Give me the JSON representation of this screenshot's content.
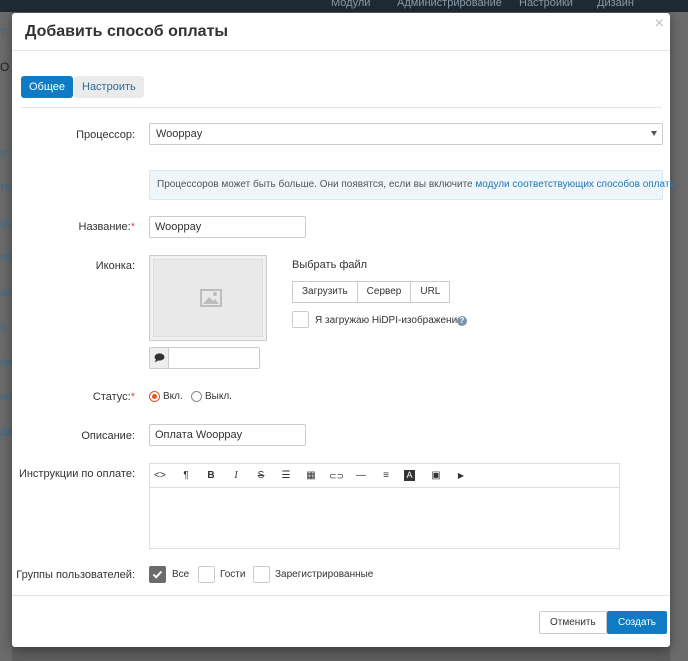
{
  "backdrop": {
    "menu": [
      "Модули",
      "Администрирование",
      "Настройки",
      "Дизайн"
    ],
    "side_letters": [
      "Т",
      "О",
      "ко",
      "та",
      "уд",
      "оба",
      "оп",
      "о",
      "ом",
      "ил",
      "ди"
    ]
  },
  "modal": {
    "title": "Добавить способ оплаты",
    "close": "×",
    "tabs": [
      {
        "label": "Общее",
        "active": true
      },
      {
        "label": "Настроить",
        "active": false
      }
    ]
  },
  "form": {
    "processor": {
      "label": "Процессор:",
      "value": "Wooppay"
    },
    "info": {
      "text": "Процессоров может быть больше. Они появятся, если вы включите ",
      "link": "модули соответствующих способов оплаты",
      "tail": "."
    },
    "name": {
      "label": "Название:",
      "required_mark": "*",
      "value": "Wooppay"
    },
    "icon": {
      "label": "Иконка:",
      "choose_file": "Выбрать файл",
      "buttons": [
        "Загрузить",
        "Сервер",
        "URL"
      ],
      "hidpi_label": "Я загружаю HiDPI-изображение.",
      "help": "?",
      "placeholder_icon": "image-icon",
      "comment_icon": "comment-icon",
      "comment_value": ""
    },
    "status": {
      "label": "Статус:",
      "required_mark": "*",
      "options": [
        {
          "label": "Вкл.",
          "selected": true
        },
        {
          "label": "Выкл.",
          "selected": false
        }
      ]
    },
    "description": {
      "label": "Описание:",
      "value": "Оплата Wooppay"
    },
    "instructions": {
      "label": "Инструкции по оплате:",
      "toolbar": [
        {
          "name": "code-view-icon",
          "glyph": "<>"
        },
        {
          "name": "paragraph-icon",
          "glyph": "¶"
        },
        {
          "name": "bold-icon",
          "glyph": "B"
        },
        {
          "name": "italic-icon",
          "glyph": "I"
        },
        {
          "name": "strikethrough-icon",
          "glyph": "S"
        },
        {
          "name": "list-icon",
          "glyph": "☰"
        },
        {
          "name": "table-icon",
          "glyph": "▦"
        },
        {
          "name": "link-icon",
          "glyph": "⊂⊃"
        },
        {
          "name": "horizontal-rule-icon",
          "glyph": "—"
        },
        {
          "name": "align-icon",
          "glyph": "≡"
        },
        {
          "name": "font-color-icon",
          "glyph": "A"
        },
        {
          "name": "image-icon",
          "glyph": "▣"
        },
        {
          "name": "video-icon",
          "glyph": "▶"
        }
      ],
      "content": ""
    },
    "user_groups": {
      "label": "Группы пользователей:",
      "options": [
        {
          "label": "Все",
          "checked": true
        },
        {
          "label": "Гости",
          "checked": false
        },
        {
          "label": "Зарегистрированные",
          "checked": false
        }
      ]
    }
  },
  "footer": {
    "cancel": "Отменить",
    "create": "Создать"
  },
  "colors": {
    "primary": "#0f7bc4",
    "radio_accent": "#e9531f",
    "required": "#d9534f",
    "info_bg": "#eef6fa"
  }
}
